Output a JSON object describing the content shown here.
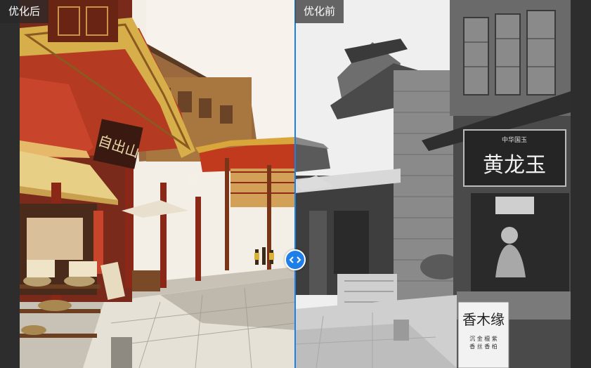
{
  "labels": {
    "after": "优化后",
    "before": "优化前"
  },
  "signs": {
    "left_gate_board": "自出山",
    "right_top_board_small": "中华国玉",
    "right_top_board": "黄龙玉",
    "right_bottom_banner": "香木缘",
    "right_bottom_banner_sub": "沉 金 檀 紫\n香 丝 香 柏"
  },
  "slider": {
    "handle_icon": "left-right-arrows-icon",
    "accent_color": "#1e7fe8"
  }
}
